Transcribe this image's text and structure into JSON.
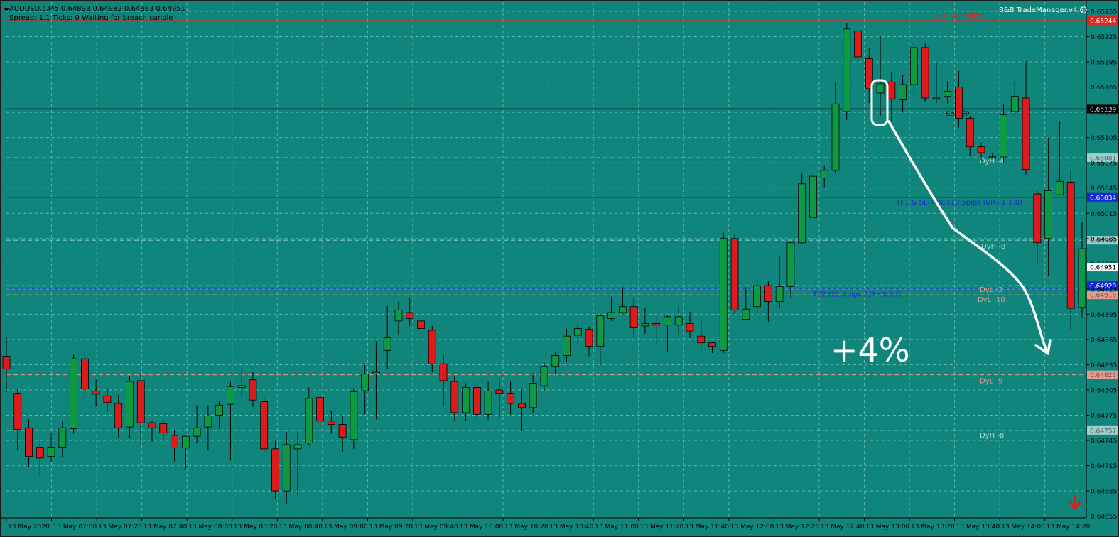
{
  "window": {
    "title": "AUDUSD.s,M5  0.64893 0.64982 0.64883 0.64951",
    "status": "Spread: 1.1   Ticks: 0   Waiting for breach candle",
    "ea_name": "B&B TradeManager.v4.8"
  },
  "colors": {
    "background": "#0f857b",
    "bull": "#0e9a44",
    "bear": "#e01a1a",
    "grid": "#5fb6ad",
    "sl_line": "#e0251f",
    "tp_line": "#1726d6",
    "entry_line": "#000000",
    "annotation": "#ffffff"
  },
  "price_axis": {
    "ticks": [
      "0.65255",
      "0.65225",
      "0.65195",
      "0.65165",
      "0.65135",
      "0.65105",
      "0.65075",
      "0.65045",
      "0.65015",
      "0.64985",
      "0.64955",
      "0.64925",
      "0.64895",
      "0.64865",
      "0.64835",
      "0.64805",
      "0.64775",
      "0.64745",
      "0.64715",
      "0.64685",
      "0.64655"
    ],
    "tick_values": [
      0.65255,
      0.65225,
      0.65195,
      0.65165,
      0.65135,
      0.65105,
      0.65075,
      0.65045,
      0.65015,
      0.64985,
      0.64955,
      0.64925,
      0.64895,
      0.64865,
      0.64835,
      0.64805,
      0.64775,
      0.64745,
      0.64715,
      0.64685,
      0.64655
    ],
    "price_min": 0.64653,
    "price_max": 0.65266,
    "current_price": "0.64951"
  },
  "time_axis": {
    "labels": [
      "13 May 2020",
      "13 May 07:00",
      "13 May 07:20",
      "13 May 07:40",
      "13 May 08:00",
      "13 May 08:20",
      "13 May 08:40",
      "13 May 09:00",
      "13 May 09:20",
      "13 May 09:40",
      "13 May 10:00",
      "13 May 10:20",
      "13 May 10:40",
      "13 May 11:00",
      "13 May 11:20",
      "13 May 11:40",
      "13 May 12:00",
      "13 May 12:20",
      "13 May 12:40",
      "13 May 13:00",
      "13 May 13:20",
      "13 May 13:40",
      "13 May 14:00",
      "13 May 14:20"
    ]
  },
  "levels": [
    {
      "name": "sl",
      "price": 0.65244,
      "price_tag": "0.65244",
      "label": "SL (-10.5pips)",
      "style": "solid",
      "color": "#e0251f",
      "tag_bg": "#e0251f",
      "label_color": "#e0251f"
    },
    {
      "name": "entry",
      "price": 0.65139,
      "price_tag": "0.65139",
      "label": "Sell EP",
      "style": "solid",
      "color": "#000000",
      "tag_bg": "#000000",
      "label_color": "#000000"
    },
    {
      "name": "dyh4",
      "price": 0.65081,
      "price_tag": "0.65081",
      "label": "DyH -4",
      "style": "dash",
      "color": "#8fd3cc",
      "tag_bg": "#9fcfca",
      "label_color": "#a8dcd6"
    },
    {
      "name": "tp1",
      "price": 0.65034,
      "price_tag": "0.65034",
      "label": "TP1 & SL->BE (10.5pips R/R=1:1.0)",
      "style": "solid",
      "color": "#1726d6",
      "tag_bg": "#1726d6",
      "label_color": "#1a2ad8"
    },
    {
      "name": "dyh8",
      "price": 0.64983,
      "price_tag": "0.64983",
      "label": "DyH -8",
      "style": "dash",
      "color": "#8fd3cc",
      "tag_bg": "#9fcfca",
      "label_color": "#a8dcd6"
    },
    {
      "name": "dyl3",
      "price": 0.64929,
      "price_tag": "0.64929",
      "label": "DyL -3",
      "style": "dash",
      "color": "#e89a8f",
      "tag_bg": "#1726d6",
      "label_color": "#e89a8f"
    },
    {
      "name": "tp2",
      "price": 0.64926,
      "price_tag": "",
      "label": "TP2 (21.0pips R/R=1:2.0)",
      "style": "solid",
      "color": "#1726d6",
      "tag_bg": "#1726d6",
      "label_color": "#1a2ad8"
    },
    {
      "name": "dyl10",
      "price": 0.64918,
      "price_tag": "0.64918",
      "label": "DyL -10",
      "style": "dash",
      "color": "#e89a8f",
      "tag_bg": "#e89a8f",
      "label_color": "#e89a8f"
    },
    {
      "name": "dyl9",
      "price": 0.64823,
      "price_tag": "0.64823",
      "label": "DyL -9",
      "style": "dash",
      "color": "#e89a8f",
      "tag_bg": "#e89a8f",
      "label_color": "#e89a8f"
    },
    {
      "name": "dyh8b",
      "price": 0.64757,
      "price_tag": "0.64757",
      "label": "DyH -8",
      "style": "dash",
      "color": "#8fd3cc",
      "tag_bg": "#9fcfca",
      "label_color": "#a8dcd6"
    }
  ],
  "annotation": {
    "text": "+4%"
  },
  "trade_direction_icon": "down-arrow-icon",
  "candles": [
    [
      0.64845,
      0.6483,
      0.64868,
      0.64802
    ],
    [
      0.64801,
      0.64758,
      0.64806,
      0.64733
    ],
    [
      0.6476,
      0.64726,
      0.6477,
      0.64713
    ],
    [
      0.64737,
      0.64724,
      0.64742,
      0.64702
    ],
    [
      0.64726,
      0.64737,
      0.64754,
      0.6472
    ],
    [
      0.64737,
      0.6476,
      0.64768,
      0.64725
    ],
    [
      0.64759,
      0.64842,
      0.64847,
      0.64753
    ],
    [
      0.64842,
      0.64806,
      0.6485,
      0.6479
    ],
    [
      0.64804,
      0.648,
      0.64818,
      0.64785
    ],
    [
      0.64798,
      0.6479,
      0.64807,
      0.64779
    ],
    [
      0.64789,
      0.6476,
      0.64799,
      0.64748
    ],
    [
      0.64761,
      0.64815,
      0.64821,
      0.64748
    ],
    [
      0.64816,
      0.64766,
      0.64825,
      0.64741
    ],
    [
      0.64766,
      0.6476,
      0.64768,
      0.64744
    ],
    [
      0.64765,
      0.64754,
      0.6477,
      0.64746
    ],
    [
      0.64751,
      0.64736,
      0.64757,
      0.6472
    ],
    [
      0.64736,
      0.6475,
      0.64751,
      0.6471
    ],
    [
      0.6475,
      0.6476,
      0.64787,
      0.64742
    ],
    [
      0.64761,
      0.64774,
      0.64787,
      0.64733
    ],
    [
      0.64775,
      0.64787,
      0.64792,
      0.64759
    ],
    [
      0.64788,
      0.64809,
      0.64815,
      0.64721
    ],
    [
      0.64808,
      0.6481,
      0.64829,
      0.64798
    ],
    [
      0.64817,
      0.64793,
      0.64826,
      0.64785
    ],
    [
      0.64791,
      0.64735,
      0.64795,
      0.64731
    ],
    [
      0.64735,
      0.64685,
      0.64745,
      0.64675
    ],
    [
      0.64685,
      0.6474,
      0.64755,
      0.6467
    ],
    [
      0.64735,
      0.6474,
      0.64755,
      0.6468
    ],
    [
      0.64742,
      0.64795,
      0.64808,
      0.64739
    ],
    [
      0.64796,
      0.64768,
      0.64812,
      0.64758
    ],
    [
      0.64768,
      0.64764,
      0.6478,
      0.64753
    ],
    [
      0.64764,
      0.64749,
      0.64775,
      0.64731
    ],
    [
      0.64746,
      0.64803,
      0.64807,
      0.64735
    ],
    [
      0.64804,
      0.64824,
      0.64835,
      0.64776
    ],
    [
      0.64824,
      0.64826,
      0.64863,
      0.6477
    ],
    [
      0.64852,
      0.64867,
      0.64905,
      0.6483
    ],
    [
      0.64887,
      0.649,
      0.6491,
      0.6487
    ],
    [
      0.64897,
      0.6489,
      0.64915,
      0.64881
    ],
    [
      0.64887,
      0.64878,
      0.6489,
      0.64838
    ],
    [
      0.64876,
      0.64836,
      0.64881,
      0.64826
    ],
    [
      0.64836,
      0.64816,
      0.64848,
      0.64785
    ],
    [
      0.64815,
      0.64778,
      0.64822,
      0.64768
    ],
    [
      0.64778,
      0.64808,
      0.64813,
      0.64768
    ],
    [
      0.64808,
      0.64776,
      0.64813,
      0.64768
    ],
    [
      0.64776,
      0.64804,
      0.64815,
      0.6477
    ],
    [
      0.64805,
      0.64801,
      0.64818,
      0.64771
    ],
    [
      0.64801,
      0.64789,
      0.64815,
      0.64776
    ],
    [
      0.64789,
      0.64784,
      0.64807,
      0.64756
    ],
    [
      0.64784,
      0.64813,
      0.64825,
      0.64778
    ],
    [
      0.6481,
      0.64833,
      0.64837,
      0.64804
    ],
    [
      0.64833,
      0.64846,
      0.6485,
      0.64823
    ],
    [
      0.64846,
      0.64869,
      0.64878,
      0.64838
    ],
    [
      0.6487,
      0.64878,
      0.64885,
      0.6486
    ],
    [
      0.64877,
      0.64857,
      0.6488,
      0.64845
    ],
    [
      0.64857,
      0.64893,
      0.64895,
      0.64835
    ],
    [
      0.6489,
      0.64897,
      0.64916,
      0.64887
    ],
    [
      0.64897,
      0.64904,
      0.64927,
      0.64895
    ],
    [
      0.64904,
      0.64879,
      0.64915,
      0.64868
    ],
    [
      0.64881,
      0.64884,
      0.64903,
      0.64872
    ],
    [
      0.64884,
      0.64882,
      0.64893,
      0.6486
    ],
    [
      0.64882,
      0.64892,
      0.64894,
      0.6485
    ],
    [
      0.64882,
      0.64892,
      0.64904,
      0.64869
    ],
    [
      0.64884,
      0.64875,
      0.64898,
      0.64867
    ],
    [
      0.64869,
      0.64861,
      0.64888,
      0.64852
    ],
    [
      0.64861,
      0.64857,
      0.64862,
      0.64849
    ],
    [
      0.64852,
      0.64985,
      0.64992,
      0.64849
    ],
    [
      0.64985,
      0.649,
      0.6499,
      0.64895
    ],
    [
      0.64889,
      0.64901,
      0.64927,
      0.64891
    ],
    [
      0.64904,
      0.64929,
      0.6494,
      0.64895
    ],
    [
      0.64929,
      0.6491,
      0.64935,
      0.64886
    ],
    [
      0.6491,
      0.64928,
      0.64965,
      0.64902
    ],
    [
      0.64928,
      0.6498,
      0.64982,
      0.64915
    ],
    [
      0.6498,
      0.6505,
      0.65062,
      0.64978
    ],
    [
      0.6501,
      0.65059,
      0.65063,
      0.65008
    ],
    [
      0.65057,
      0.65066,
      0.65071,
      0.65046
    ],
    [
      0.65066,
      0.65145,
      0.65171,
      0.65062
    ],
    [
      0.65136,
      0.65234,
      0.65241,
      0.65126
    ],
    [
      0.65232,
      0.65201,
      0.65233,
      0.65186
    ],
    [
      0.65199,
      0.65163,
      0.65211,
      0.65146
    ],
    [
      0.65158,
      0.65169,
      0.65226,
      0.6513
    ],
    [
      0.65171,
      0.65151,
      0.65183,
      0.65124
    ],
    [
      0.6515,
      0.65168,
      0.65179,
      0.65135
    ],
    [
      0.65168,
      0.65212,
      0.65217,
      0.65157
    ],
    [
      0.65212,
      0.65152,
      0.65217,
      0.65148
    ],
    [
      0.65152,
      0.65152,
      0.65194,
      0.65146
    ],
    [
      0.65154,
      0.6516,
      0.65172,
      0.65145
    ],
    [
      0.65165,
      0.65128,
      0.65184,
      0.65117
    ],
    [
      0.65128,
      0.65094,
      0.6513,
      0.65083
    ],
    [
      0.65094,
      0.65087,
      0.65099,
      0.65078
    ],
    [
      0.65081,
      0.65082,
      0.65086,
      0.6508
    ],
    [
      0.65082,
      0.65132,
      0.65145,
      0.65075
    ],
    [
      0.65136,
      0.65154,
      0.65172,
      0.6513
    ],
    [
      0.65152,
      0.65067,
      0.65196,
      0.6506
    ],
    [
      0.65038,
      0.6498,
      0.65042,
      0.64955
    ],
    [
      0.64985,
      0.65042,
      0.65105,
      0.6494
    ],
    [
      0.65037,
      0.65053,
      0.65125,
      0.65036
    ],
    [
      0.65052,
      0.64902,
      0.65066,
      0.64877
    ],
    [
      0.64903,
      0.64973,
      0.65005,
      0.6489
    ]
  ]
}
